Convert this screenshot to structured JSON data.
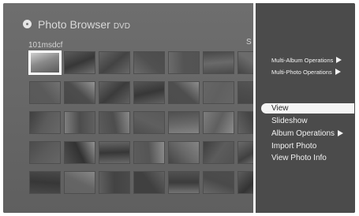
{
  "header": {
    "title": "Photo Browser",
    "source": "DVD"
  },
  "browser": {
    "folder": "101msdcf",
    "truncated_label": "S"
  },
  "menu": {
    "items": [
      {
        "label": "Multi-Album Operations",
        "submenu": true
      },
      {
        "label": "Multi-Photo Operations",
        "submenu": true
      },
      {
        "label": "View",
        "submenu": false,
        "selected": true
      },
      {
        "label": "Slideshow",
        "submenu": false
      },
      {
        "label": "Album Operations",
        "submenu": true
      },
      {
        "label": "Import Photo",
        "submenu": false
      },
      {
        "label": "View Photo Info",
        "submenu": false
      }
    ]
  },
  "grid": {
    "rows": 5,
    "cols": 7,
    "selected_index": 0
  },
  "colors": {
    "screen_bg": "#676767",
    "menu_bg": "#4b4b4b",
    "highlight": "#f4f4f4",
    "divider": "#f5f5f5"
  }
}
